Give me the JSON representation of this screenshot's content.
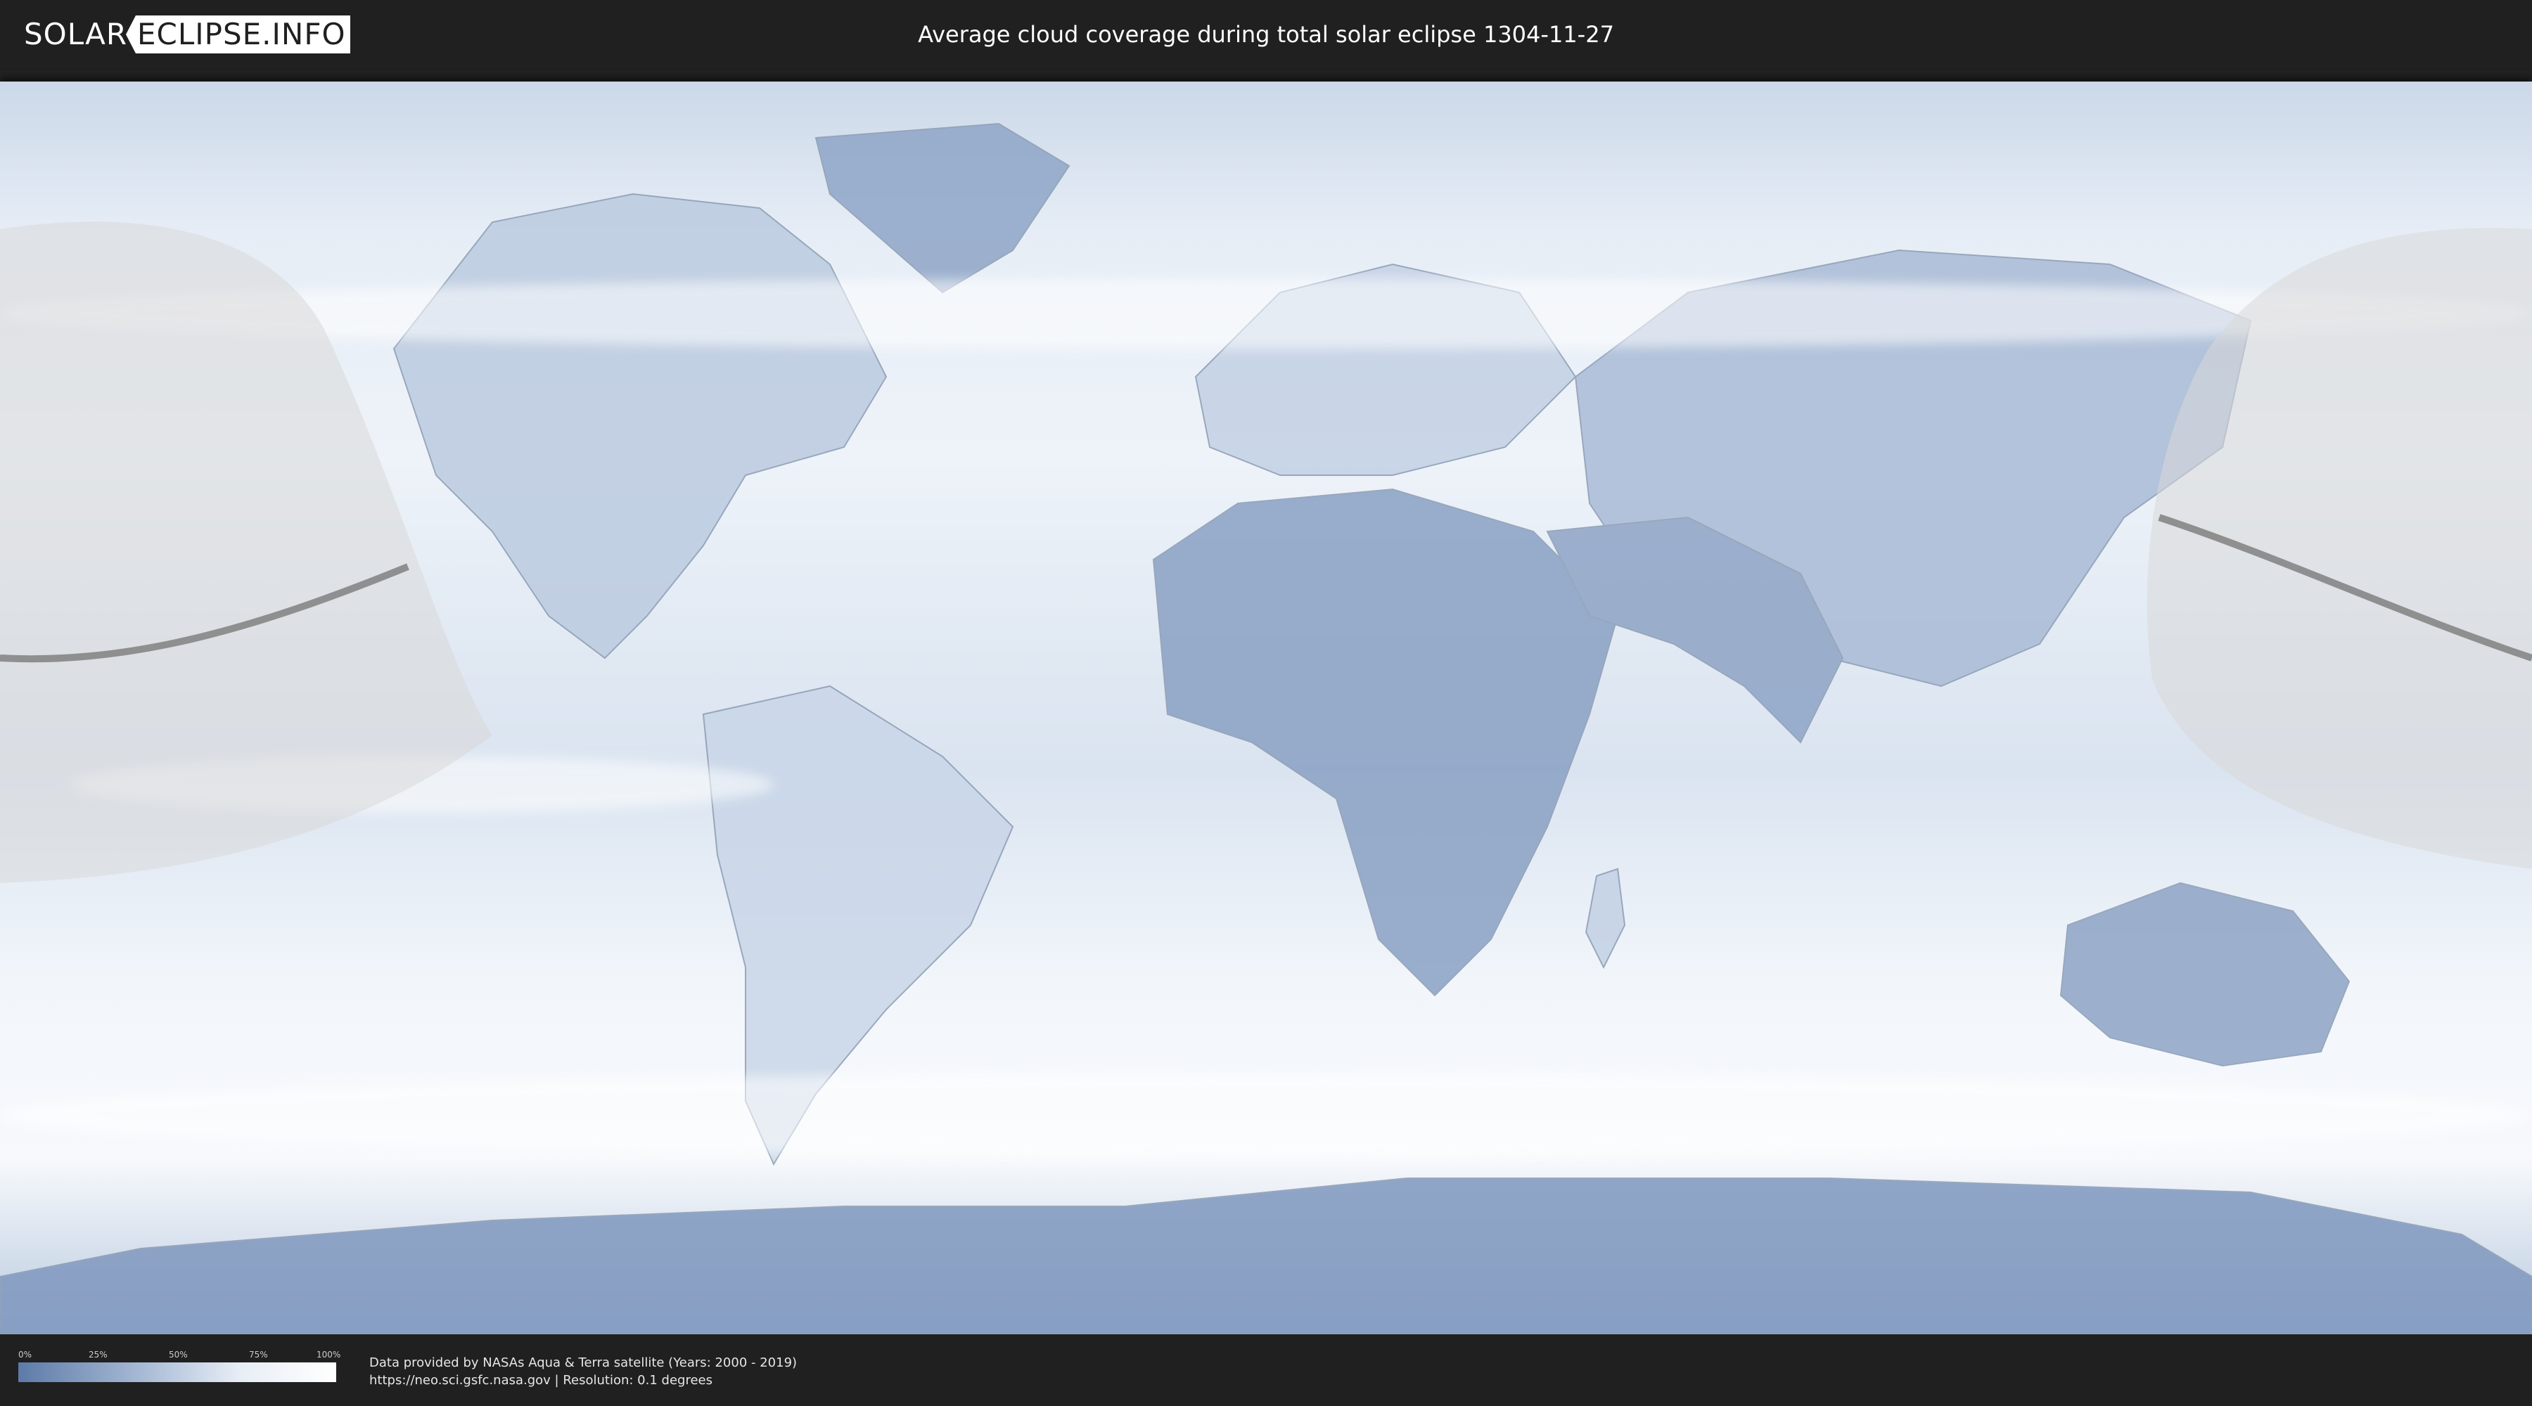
{
  "header": {
    "logo_left": "SOLAR",
    "logo_right": "ECLIPSE.INFO",
    "title": "Average cloud coverage during total solar eclipse 1304-11-27"
  },
  "legend": {
    "labels": [
      "0%",
      "25%",
      "50%",
      "75%",
      "100%"
    ],
    "values": [
      0,
      25,
      50,
      75,
      100
    ],
    "color_low": "#5d7aa8",
    "color_high": "#ffffff"
  },
  "credits": {
    "line1": "Data provided by NASAs Aqua & Terra satellite (Years: 2000 - 2019)",
    "line2": "https://neo.sci.gsfc.nasa.gov | Resolution: 0.1 degrees"
  },
  "colors": {
    "background": "#202020",
    "clear_sky": "#5d7aa8",
    "cloudy": "#ffffff",
    "eclipse_path": "#808080",
    "night_shading": "#d9d9d9"
  }
}
